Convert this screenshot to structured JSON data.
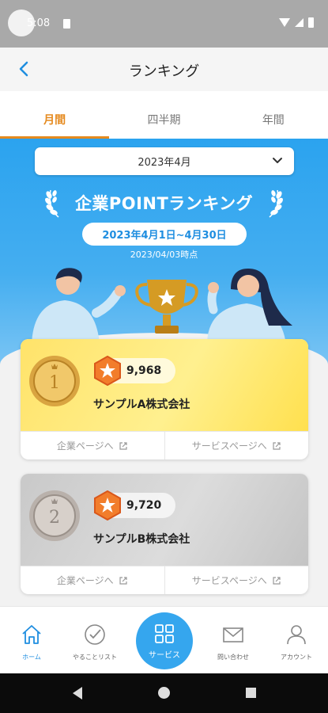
{
  "status": {
    "time": "5:08"
  },
  "header": {
    "title": "ランキング"
  },
  "tabs": [
    {
      "label": "月間",
      "active": true
    },
    {
      "label": "四半期",
      "active": false
    },
    {
      "label": "年間",
      "active": false
    }
  ],
  "selector": {
    "value": "2023年4月"
  },
  "hero": {
    "title": "企業POINTランキング",
    "period": "2023年4月1日~4月30日",
    "as_of": "2023/04/03時点"
  },
  "rankings": [
    {
      "rank": "1",
      "points": "9,968",
      "company": "サンプルA株式会社",
      "company_link": "企業ページへ",
      "service_link": "サービスページへ"
    },
    {
      "rank": "2",
      "points": "9,720",
      "company": "サンプルB株式会社",
      "company_link": "企業ページへ",
      "service_link": "サービスページへ"
    }
  ],
  "nav": {
    "home": "ホーム",
    "todo": "やることリスト",
    "service": "サービス",
    "contact": "問い合わせ",
    "account": "アカウント"
  },
  "colors": {
    "accent": "#e58a1f",
    "primary": "#2ba3ef",
    "gold": "#ffe36a",
    "silver": "#c9c9c9"
  }
}
